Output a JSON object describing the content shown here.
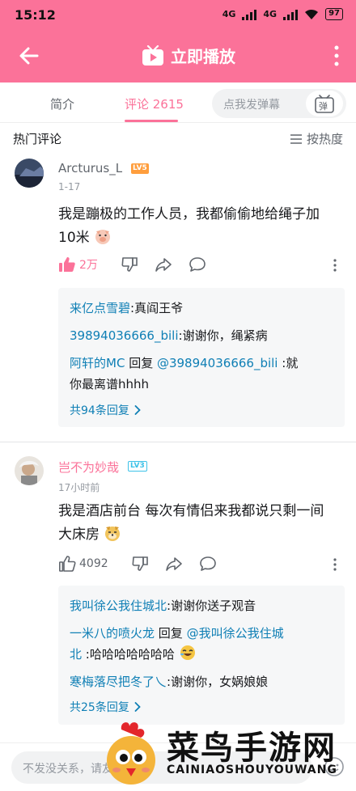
{
  "status": {
    "time": "15:12",
    "net1": "4G",
    "net2": "4G",
    "battery": "97"
  },
  "appbar": {
    "title": "立即播放"
  },
  "tabs": {
    "intro": "简介",
    "comments": "评论 2615",
    "danmu_placeholder": "点我发弹幕",
    "danmu_btn": "弹"
  },
  "section": {
    "title": "热门评论",
    "sort_label": "按热度"
  },
  "comments": [
    {
      "user": "Arcturus_L",
      "level": "LV5",
      "time": "1-17",
      "text_line1": "我是蹦极的工作人员，我都偷偷地给绳子加",
      "text_line2": "10米",
      "likes": "2万",
      "replies": [
        {
          "user": "来亿点雪碧",
          "sep": ":",
          "text": "真阎王爷"
        },
        {
          "user": "39894036666_bili",
          "sep": ":",
          "text": "谢谢你，绳紧病"
        },
        {
          "user": "阿轩的MC",
          "mid": " 回复 ",
          "target": "@39894036666_bili",
          "sep": " :",
          "text": "就",
          "text2": "你最离谱hhhh"
        }
      ],
      "more_replies": "共94条回复"
    },
    {
      "user": "岂不为妙哉",
      "level": "LV3",
      "time": "17小时前",
      "text_line1": "我是酒店前台 每次有情侣来我都说只剩一间",
      "text_line2": "大床房",
      "likes": "4092",
      "replies": [
        {
          "user": "我叫徐公我住城北",
          "sep": ":",
          "text": "谢谢你送子观音"
        },
        {
          "user": "一米八的喷火龙",
          "mid": " 回复 ",
          "target": "@我叫徐公我住城",
          "target2": "北",
          "sep": " :",
          "text": "哈哈哈哈哈哈哈"
        },
        {
          "user": "寒梅落尽把冬了乀",
          "sep": ":",
          "text": "谢谢你，女娲娘娘"
        }
      ],
      "more_replies": "共25条回复"
    }
  ],
  "bottom": {
    "placeholder": "不发没关系，请友善哦～"
  },
  "watermark": {
    "main": "菜鸟手游网",
    "sub": "CAINIAOSHOUYOUWANG"
  },
  "colors": {
    "brand": "#fb7299",
    "link": "#0f7fb5",
    "muted": "#9499a0"
  }
}
